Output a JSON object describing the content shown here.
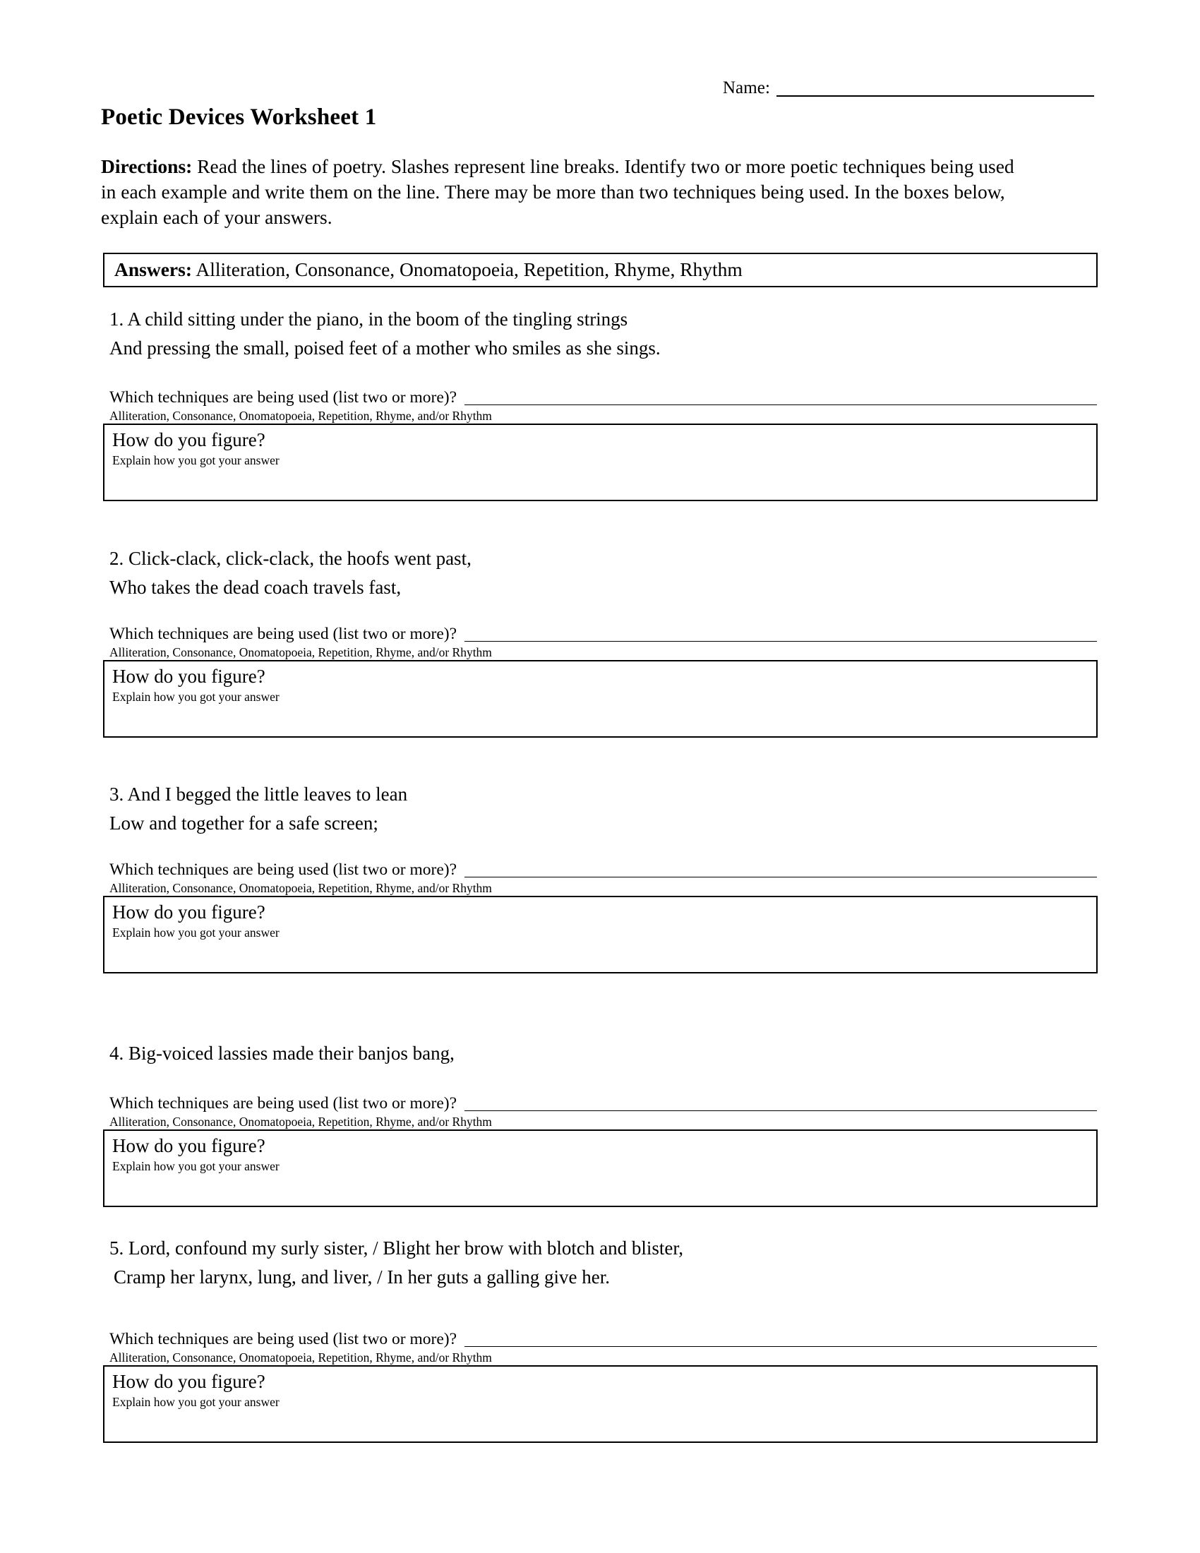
{
  "header": {
    "name_label": "Name:",
    "title": "Poetic Devices Worksheet 1"
  },
  "directions": {
    "label": "Directions:",
    "text": " Read the lines of poetry. Slashes represent line breaks. Identify two or more poetic techniques being used in each example and write them on the line. There may be more than two techniques being used. In the boxes below, explain each of your answers."
  },
  "answers_bar": {
    "label": "Answers:",
    "text": " Alliteration, Consonance, Onomatopoeia, Repetition, Rhyme, Rhythm"
  },
  "common": {
    "prompt": "Which techniques are being used (list two or more)?",
    "hint": "Alliteration, Consonance, Onomatopoeia, Repetition, Rhyme, and/or Rhythm",
    "figure_title": "How do you figure?",
    "figure_sub": "Explain how you got your answer"
  },
  "questions": [
    {
      "number": "1.",
      "line1": "1. A child sitting under the piano, in the boom of the tingling strings",
      "line2": "And pressing the small, poised feet of a mother who smiles as she sings."
    },
    {
      "number": "2.",
      "line1": "2. Click-clack, click-clack, the hoofs went past,",
      "line2": "Who takes the dead coach travels fast,"
    },
    {
      "number": "3.",
      "line1": "3. And I begged the little leaves to lean",
      "line2": "Low and together for a safe screen;"
    },
    {
      "number": "4.",
      "line1": "4. Big-voiced lassies made their banjos bang,",
      "line2": ""
    },
    {
      "number": "5.",
      "line1": "5. Lord, confound my surly sister, / Blight her brow with blotch and blister,",
      "line2": "Cramp her larynx, lung, and liver, / In her guts a galling give her."
    }
  ]
}
